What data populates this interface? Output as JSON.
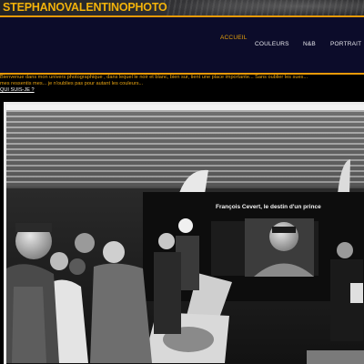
{
  "site": {
    "title": "STEPHANOVALENTINOPHOTO"
  },
  "nav": {
    "items": [
      {
        "label": "ACCUEIL",
        "active": true
      },
      {
        "label": "COULEURS",
        "active": false
      },
      {
        "label": "N&B",
        "active": false
      },
      {
        "label": "PORTRAIT",
        "active": false
      }
    ]
  },
  "intro": {
    "line1": "Bienvenue dans mon univers photographique , dans lequel le noir et blanc, bien sur, tient une place importante... Sans oublier les sues...",
    "line2": "mes ressentis mes... je n'oublies pas pour autant les couleurs...",
    "link": "QUI SUIS-JE ?"
  },
  "photo": {
    "poster_caption": "François Cevert, le destin d'un prince"
  },
  "colors": {
    "accent": "#e89a08",
    "title": "#f2b20a",
    "nav_background": "#0c0c2a",
    "nav_text": "#e8e8ee"
  }
}
